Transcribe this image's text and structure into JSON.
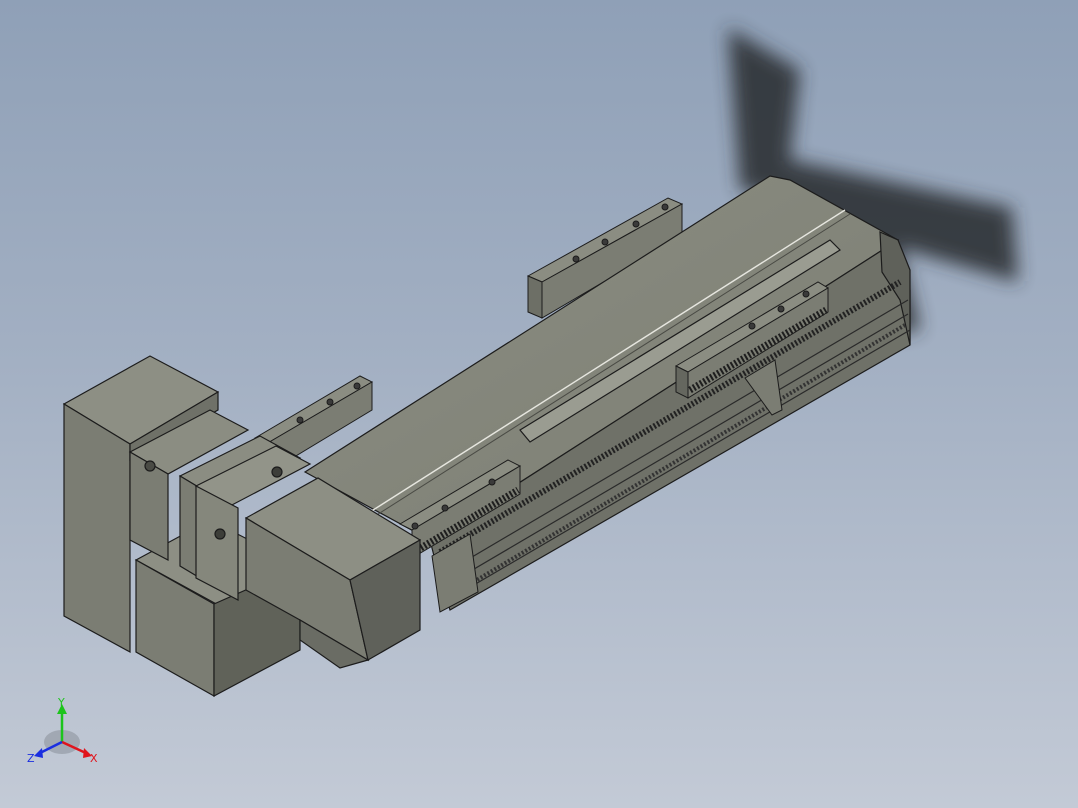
{
  "viewport": {
    "background_top": "#8fa0b7",
    "background_bottom": "#c3cad6"
  },
  "model": {
    "body_color": "#7d7f74",
    "face_light": "#8a8c81",
    "face_dark": "#5f615a",
    "edge_color": "#1c1c1c",
    "shadow_color": "#2e3035"
  },
  "triad": {
    "x_label": "X",
    "y_label": "Y",
    "z_label": "Z",
    "x_color": "#e0141c",
    "y_color": "#1cc41c",
    "z_color": "#1a2ee0"
  }
}
